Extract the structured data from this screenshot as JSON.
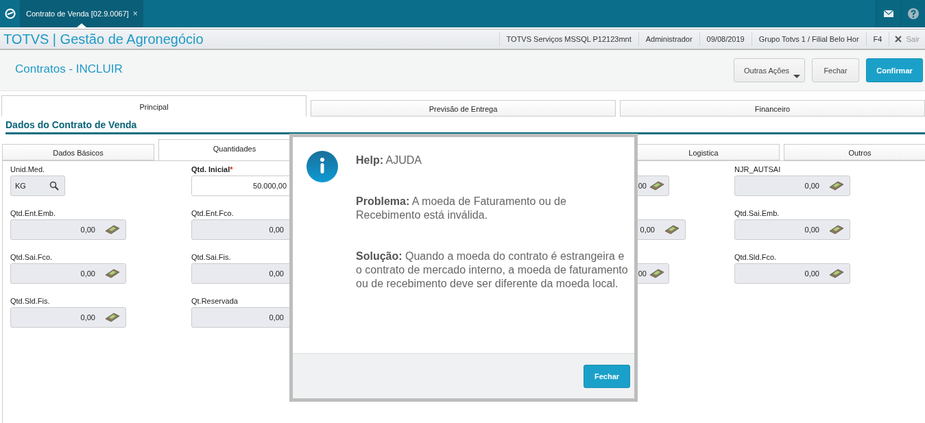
{
  "topbar": {
    "tab": {
      "label": "Contrato de Venda [02.9.0067]",
      "close": "×",
      "selected": true
    }
  },
  "header": {
    "title": "TOTVS | Gestão de Agronegócio",
    "info": [
      "TOTVS Serviços MSSQL P12123mnt",
      "Administrador",
      "09/08/2019",
      "Grupo Totvs 1 / Filial Belo Hor",
      "F4"
    ],
    "exit": "Sair"
  },
  "page": {
    "title": "Contratos - INCLUIR",
    "buttons": [
      {
        "label": "Outras Ações",
        "kind": "menu"
      },
      {
        "label": "Fechar",
        "kind": "default"
      },
      {
        "label": "Confirmar",
        "kind": "primary"
      }
    ]
  },
  "tabs": [
    {
      "label": "Principal",
      "selected": true
    },
    {
      "label": "Previsão de Entrega",
      "selected": false
    },
    {
      "label": "Financeiro",
      "selected": false
    }
  ],
  "section": "Dados do Contrato de Venda",
  "subtabs": [
    {
      "label": "Dados Básicos",
      "selected": false
    },
    {
      "label": "Quantidades",
      "selected": true
    },
    {
      "label": "Logistica",
      "selected": false
    },
    {
      "label": "Outros",
      "selected": false
    }
  ],
  "columns": [
    [
      {
        "label": "Unid.Med.",
        "value": "KG",
        "kind": "lookup"
      },
      {
        "label": "Qtd.Ent.Emb.",
        "value": "0,00",
        "kind": "calc"
      },
      {
        "label": "Qtd.Sai.Fco.",
        "value": "0,00",
        "kind": "calc"
      },
      {
        "label": "Qtd.Sld.Fis.",
        "value": "0,00",
        "kind": "calc"
      }
    ],
    [
      {
        "label": "Qtd. Inicial",
        "required_mark": "*",
        "value": "50.000,00",
        "kind": "input"
      },
      {
        "label": "Qtd.Ent.Fco.",
        "value": "0,00",
        "kind": "plain"
      },
      {
        "label": "Qtd.Sai.Fis.",
        "value": "0,00",
        "kind": "plain"
      },
      {
        "label": "Qt.Reservada",
        "value": "0,00",
        "kind": "plain"
      }
    ],
    [
      {
        "value": "00",
        "kind": "calc-edge"
      },
      {
        "value": "0,00",
        "kind": "calc-wide"
      },
      {
        "value": "00",
        "kind": "calc-edge"
      }
    ],
    [
      {
        "label": "NJR_AUTSAI",
        "value": "0,00",
        "kind": "calc"
      },
      {
        "label": "Qtd.Sai.Emb.",
        "value": "0,00",
        "kind": "calc"
      },
      {
        "label": "Qtd.Sld.Fco.",
        "value": "0,00",
        "kind": "calc"
      }
    ]
  ],
  "dialog": {
    "heading": "**Help:** AJUDA",
    "problem": "**Problema:** A moeda de Faturamento ou de Recebimento está inválida.",
    "solution": "**Solução:** Quando a moeda do contrato é estrangeira e o contrato de mercado interno, a moeda de faturamento ou de recebimento deve ser diferente da moeda local.",
    "button": "Fechar"
  }
}
